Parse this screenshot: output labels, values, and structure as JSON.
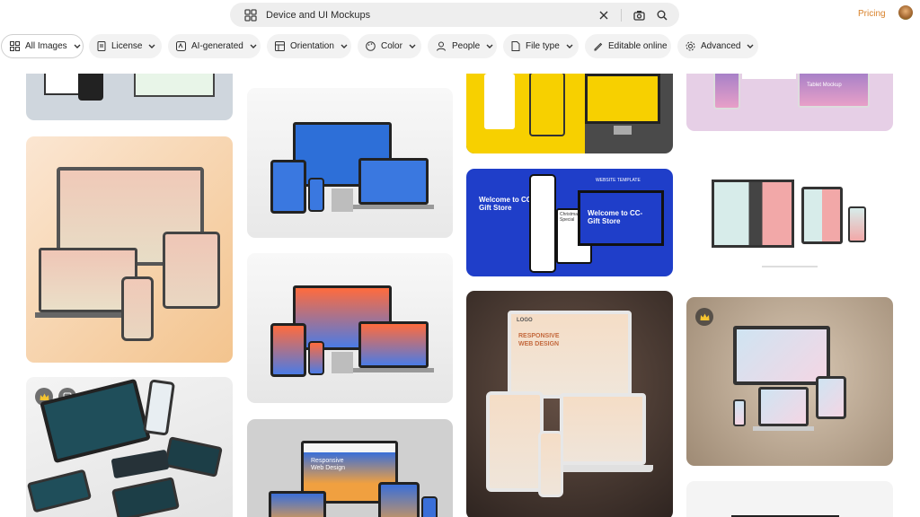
{
  "search": {
    "query": "Device and UI Mockups"
  },
  "header": {
    "pricing_label": "Pricing"
  },
  "filters": [
    {
      "label": "All Images",
      "icon": "grid-icon",
      "active": true
    },
    {
      "label": "License",
      "icon": "license-icon"
    },
    {
      "label": "AI-generated",
      "icon": "ai-icon"
    },
    {
      "label": "Orientation",
      "icon": "orientation-icon"
    },
    {
      "label": "Color",
      "icon": "palette-icon"
    },
    {
      "label": "People",
      "icon": "people-icon"
    },
    {
      "label": "File type",
      "icon": "file-icon"
    },
    {
      "label": "Editable online",
      "icon": "pen-icon"
    },
    {
      "label": "Advanced",
      "icon": "gear-icon"
    }
  ],
  "tiles": {
    "t5_text_a": "WEBSITE TEMPLATE",
    "t5_text_b": "Welcome to CC- Gift Store",
    "t5_text_c": "Welcome to CC-Gift Store",
    "t5_text_d": "Christmas Special",
    "t8_text_a": "Responsive Web Design",
    "t9_logo": "LOGO",
    "t9_title": "RESPONSIVE WEB DESIGN",
    "t11_title": "Responsive Web Design",
    "t12_a": "Tablet Mockup"
  },
  "colors": {
    "accent": "#d9822b",
    "chip_bg": "#f2f2f2"
  }
}
